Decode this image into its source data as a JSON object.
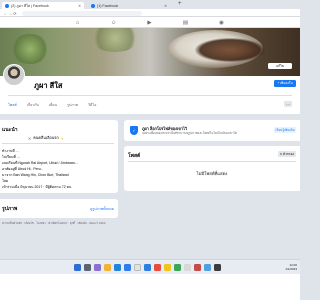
{
  "browser": {
    "tabs": [
      {
        "title": "(2) ภูผา สีใส | Facebook",
        "active": true
      },
      {
        "title": "(1) Facebook",
        "active": false
      }
    ],
    "new_tab": "+"
  },
  "profile": {
    "name": "ภูผา สีใส",
    "add_story_label": "+ เพิ่มลงใน",
    "edit_cover_label": "แก้ไข",
    "tabs": [
      "โพสต์",
      "เกี่ยวกับ",
      "เพื่อน",
      "รูปภาพ",
      "วิดีโอ"
    ],
    "more": "···"
  },
  "intro": {
    "title": "แนะนำ",
    "bio_text": "คนคลื่นเลือนรถ",
    "rows": [
      "ทำงานที่ ...",
      "ไปเรียนที่ ...",
      "เคยเรียนที่ Ngurah Rai Airport, Ubud / Jimbaran...",
      "อาศัยอยู่ที่ Ubud Hi.. Peru..",
      "มาจาก Ban Wang Hin, Chon Buri, Thailand",
      "โสด",
      "เข้าร่วมเมื่อ มิถุนายน 2017 · มีผู้ติดตาม 72 คน"
    ]
  },
  "photos": {
    "title": "รูปภาพ",
    "link": "ดูรูปภาพทั้งหมด"
  },
  "footer": "ความเป็นส่วนตัว · เงื่อนไข · โฆษณา · ตัวเลือกโฆษณา · คุกกี้ · เพิ่มเติม · Meta © 2023",
  "notice": {
    "title": "ภูผา ล็อกโปรไฟล์ของเขาไว้",
    "description": "เฉพาะเพื่อนของเขาเท่านั้นที่สามารถดูรูปภาพและโพสต์ในไทม์ไลน์ของเขาได้",
    "button": "เรียนรู้เพิ่มเติม"
  },
  "posts": {
    "title": "โพสต์",
    "filter": "ตัวกรอง",
    "empty": "ไม่มีโพสต์ที่แสดง"
  },
  "taskbar": {
    "time": "12:00",
    "date": "1/1/2023"
  }
}
